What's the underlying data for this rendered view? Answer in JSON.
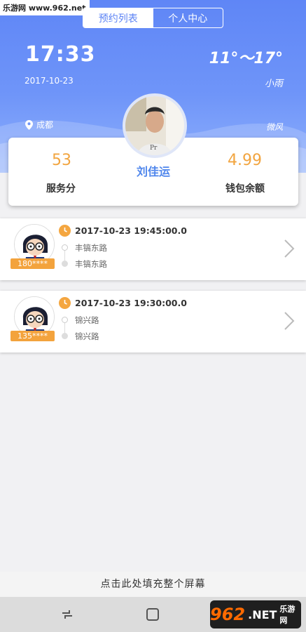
{
  "watermark_top": "乐游网 www.962.net",
  "tabs": {
    "active": "预约列表",
    "inactive": "个人中心"
  },
  "header": {
    "time": "17:33",
    "date": "2017-10-23",
    "temperature": "11°～17°",
    "weather": "小雨",
    "city": "成都",
    "wind": "微风"
  },
  "profile": {
    "name": "刘佳运",
    "score_value": "53",
    "score_label": "服务分",
    "wallet_value": "4.99",
    "wallet_label": "钱包余额"
  },
  "orders": [
    {
      "phone": "180****",
      "datetime": "2017-10-23 19:45:00.0",
      "from": "丰镐东路",
      "to": "丰镐东路"
    },
    {
      "phone": "135****",
      "datetime": "2017-10-23 19:30:00.0",
      "from": "锦兴路",
      "to": "锦兴路"
    }
  ],
  "fill_screen": "点击此处填充整个屏幕",
  "watermark_bottom": {
    "num": "962",
    "net": ".NET",
    "cn": "乐游网"
  },
  "colors": {
    "accent": "#5f86f6",
    "orange": "#f2a540",
    "name_blue": "#4f86ec"
  }
}
